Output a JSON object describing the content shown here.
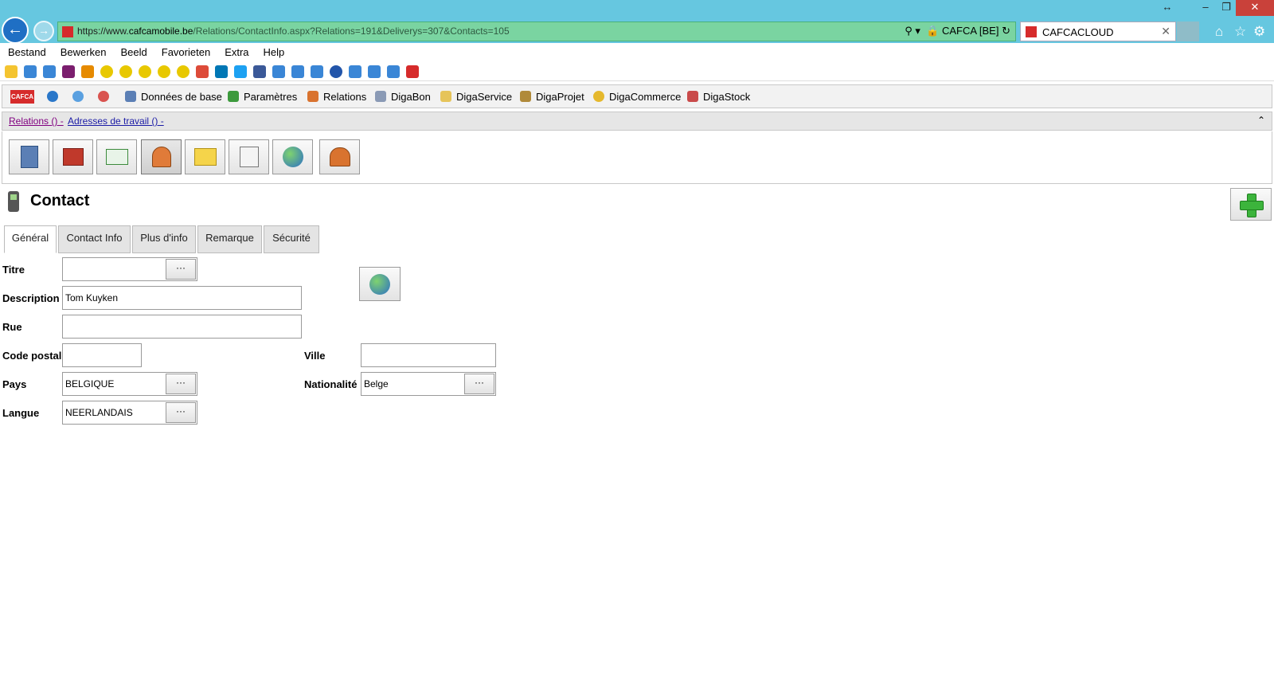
{
  "browser": {
    "url_scheme": "https://www.",
    "url_domain": "cafcamobile.be",
    "url_path": "/Relations/ContactInfo.aspx?Relations=191&Deliverys=307&Contacts=105",
    "site_identity": "CAFCA [BE]",
    "tab_title": "CAFCACLOUD"
  },
  "menu": [
    "Bestand",
    "Bewerken",
    "Beeld",
    "Favorieten",
    "Extra",
    "Help"
  ],
  "app_toolbar": {
    "logo": "CAFCA",
    "items": [
      "Données de base",
      "Paramètres",
      "Relations",
      "DigaBon",
      "DigaService",
      "DigaProjet",
      "DigaCommerce",
      "DigaStock"
    ]
  },
  "breadcrumb": {
    "first": "Relations () -",
    "second": "Adresses de travail () -"
  },
  "page": {
    "title": "Contact"
  },
  "tabs": [
    "Général",
    "Contact Info",
    "Plus d'info",
    "Remarque",
    "Sécurité"
  ],
  "form": {
    "titre_label": "Titre",
    "titre_value": "",
    "description_label": "Description",
    "description_value": "Tom Kuyken",
    "rue_label": "Rue",
    "rue_value": "",
    "code_postal_label": "Code postal",
    "code_postal_value": "",
    "ville_label": "Ville",
    "ville_value": "",
    "pays_label": "Pays",
    "pays_value": "BELGIQUE",
    "nationalite_label": "Nationalité",
    "nationalite_value": "Belge",
    "langue_label": "Langue",
    "langue_value": "NEERLANDAIS",
    "lookup_button": "···"
  },
  "colors": {
    "chrome": "#66c7e0",
    "address_bar": "#7ad4a1",
    "brand_red": "#d62b2b"
  }
}
